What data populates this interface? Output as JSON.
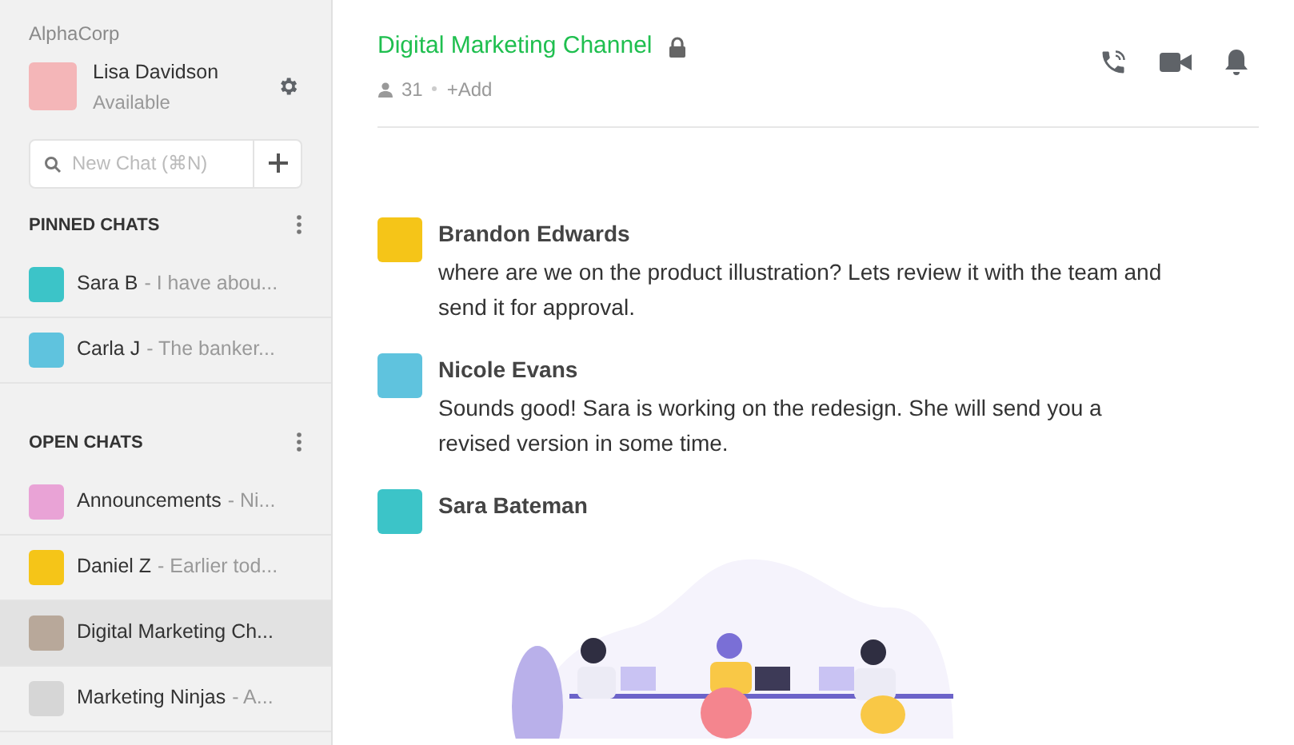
{
  "workspace": "AlphaCorp",
  "user": {
    "name": "Lisa Davidson",
    "status": "Available"
  },
  "search": {
    "placeholder": "New Chat (⌘N)"
  },
  "sections": [
    {
      "title": "PINNED CHATS",
      "chats": [
        {
          "name": "Sara B",
          "preview": "- I have abou...",
          "selected": false,
          "color": "#3cc4c8"
        },
        {
          "name": "Carla J",
          "preview": "- The banker...",
          "selected": false,
          "color": "#5fc3de"
        }
      ]
    },
    {
      "title": "OPEN CHATS",
      "chats": [
        {
          "name": "Announcements",
          "preview": "- Ni...",
          "selected": false,
          "color": "#e9a3d6"
        },
        {
          "name": "Daniel Z",
          "preview": "- Earlier tod...",
          "selected": false,
          "color": "#f5c518"
        },
        {
          "name": "Digital Marketing Ch...",
          "selected": true,
          "color": "#b8a89a"
        },
        {
          "name": "Marketing Ninjas",
          "preview": "- A...",
          "selected": false,
          "color": "#d6d6d6"
        }
      ]
    }
  ],
  "channel": {
    "title": "Digital Marketing Channel",
    "members": "31",
    "add": "+Add"
  },
  "messages": [
    {
      "author": "Brandon Edwards",
      "text": "where are we on the product illustration? Lets review it with the team and send it for approval.",
      "color": "#f5c518"
    },
    {
      "author": "Nicole Evans",
      "text": "Sounds good! Sara is working on the redesign. She will send you a revised version in some time.",
      "color": "#5fc3de"
    },
    {
      "author": "Sara Bateman",
      "color": "#3cc4c8"
    }
  ]
}
